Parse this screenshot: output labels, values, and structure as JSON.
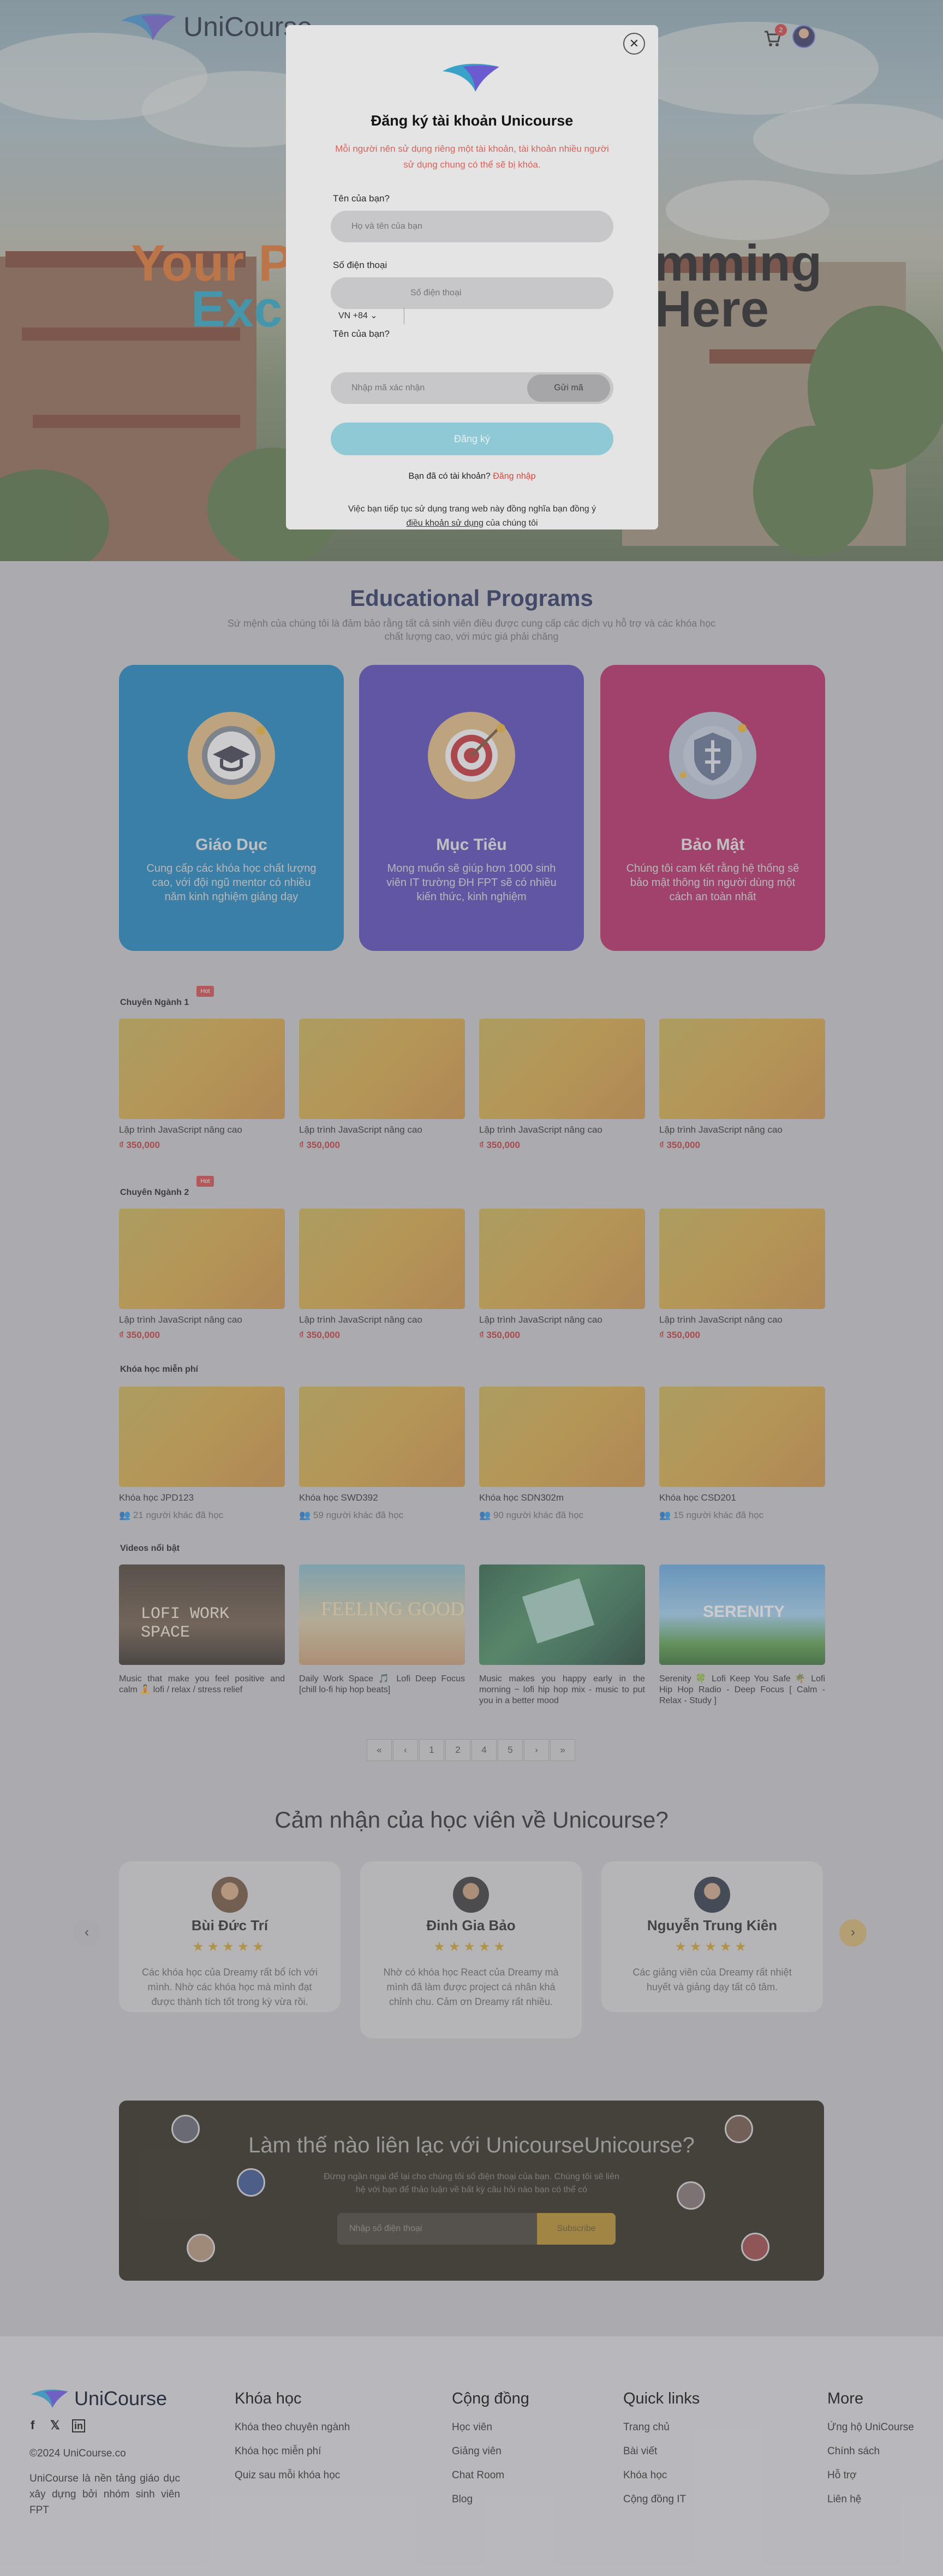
{
  "brand": {
    "name": "UniCourse",
    "accent": "#3aa1c8"
  },
  "header": {
    "cart_count": "2"
  },
  "hero": {
    "line1_left": "Your P",
    "line1_right": "mming",
    "line2_left": "Exc",
    "line2_right": "Here"
  },
  "modal": {
    "title": "Đăng ký tài khoản Unicourse",
    "subtitle": "Mỗi người nên sử dụng riêng một tài khoản, tài khoản nhiều người sử dụng chung có thể sẽ bị khóa.",
    "name_label": "Tên của bạn?",
    "name_placeholder": "Họ và tên của bạn",
    "phone_label": "Số điện thoại",
    "country": "VN +84",
    "phone_placeholder": "Số điện thoại",
    "code_label": "Tên của bạn?",
    "code_placeholder": "Nhập mã xác nhận",
    "send_code": "Gửi mã",
    "submit": "Đăng ký",
    "have_account": "Bạn đã có tài khoản?",
    "login": "Đăng nhập",
    "terms_1": "Việc bạn tiếp tục sử dụng trang web này đồng nghĩa bạn đồng ý",
    "terms_link": "điều khoản sử dụng",
    "terms_2": "của chúng tôi"
  },
  "programs": {
    "title": "Educational Programs",
    "subtitle": "Sứ mệnh của chúng tôi là đảm bảo rằng tất cả sinh viên điều được cung cấp các dịch vụ hỗ trợ và các khóa học chất lượng cao, với mức giá phải chăng",
    "cards": [
      {
        "title": "Giáo Dục",
        "text": "Cung cấp các khóa học chất lượng cao, với đội ngũ mentor có nhiều năm kinh nghiệm giảng dạy",
        "color": "#0a7fc0"
      },
      {
        "title": "Mục Tiêu",
        "text": "Mong muốn sẽ giúp hơn 1000 sinh viên IT trường ĐH FPT sẽ có nhiều kiến thức, kinh nghiệm",
        "color": "#4b3bb8"
      },
      {
        "title": "Bảo Mật",
        "text": "Chúng tôi cam kết rằng hệ thống sẽ bảo mật thông tin người dùng một cách an toàn nhất",
        "color": "#b8195c"
      }
    ]
  },
  "courses": {
    "hot": "Hot",
    "major1": {
      "title": "Chuyên Ngành 1",
      "items": [
        {
          "name": "Lập trình JavaScript nâng cao",
          "price": "₫ 350,000"
        },
        {
          "name": "Lập trình JavaScript nâng cao",
          "price": "₫ 350,000"
        },
        {
          "name": "Lập trình JavaScript nâng cao",
          "price": "₫ 350,000"
        },
        {
          "name": "Lập trình JavaScript nâng cao",
          "price": "₫ 350,000"
        }
      ]
    },
    "major2": {
      "title": "Chuyên Ngành 2",
      "items": [
        {
          "name": "Lập trình JavaScript nâng cao",
          "price": "₫ 350,000"
        },
        {
          "name": "Lập trình JavaScript nâng cao",
          "price": "₫ 350,000"
        },
        {
          "name": "Lập trình JavaScript nâng cao",
          "price": "₫ 350,000"
        },
        {
          "name": "Lập trình JavaScript nâng cao",
          "price": "₫ 350,000"
        }
      ]
    },
    "free": {
      "title": "Khóa học miễn phí",
      "items": [
        {
          "name": "Khóa học JPD123",
          "meta": "21 người khác đã học"
        },
        {
          "name": "Khóa học SWD392",
          "meta": "59 người khác đã học"
        },
        {
          "name": "Khóa học SDN302m",
          "meta": "90 người khác đã học"
        },
        {
          "name": "Khóa học CSD201",
          "meta": "15 người khác đã học"
        }
      ]
    },
    "videos": {
      "title": "Videos nổi bật",
      "items": [
        {
          "name": "Music that make you feel positive and calm 🧘 lofi / relax / stress relief",
          "caption": "LOFI WORK SPACE"
        },
        {
          "name": "Daily Work Space 🎵 Lofi Deep Focus [chill lo-fi hip hop beats]",
          "caption": "FEELING GOOD"
        },
        {
          "name": "Music makes you happy early in the morning ~ lofi hip hop mix - music to put you in a better mood",
          "caption": ""
        },
        {
          "name": "Serenity 🍀 Lofi Keep You Safe 🌴 Lofi Hip Hop Radio - Deep Focus [ Calm - Relax - Study ]",
          "caption": "SERENITY"
        }
      ]
    }
  },
  "pagination": [
    "«",
    "‹",
    "1",
    "2",
    "4",
    "5",
    "›",
    "»"
  ],
  "testimonials": {
    "title": "Cảm nhận của học viên về Unicourse?",
    "stars": "★★★★★",
    "items": [
      {
        "name": "Bùi Đức Trí",
        "text": "Các khóa học của Dreamy rất bổ ích với mình. Nhờ các khóa học mà mình đạt được thành tích tốt trong kỳ vừa rồi."
      },
      {
        "name": "Đinh Gia Bảo",
        "text": "Nhờ có khóa học React của Dreamy mà mình đã làm được project cá nhân khá chỉnh chu. Cảm ơn Dreamy rất nhiều."
      },
      {
        "name": "Nguyễn Trung Kiên",
        "text": "Các giảng viên của Dreamy rất nhiệt huyết và giảng dạy tất cô tâm."
      }
    ]
  },
  "contact": {
    "title": "Làm thế nào liên lạc với UnicourseUnicourse?",
    "subtitle": "Đừng ngần ngại để lại cho chúng tôi số điện thoại của bạn. Chúng tôi sẽ liên hệ với bạn để thảo luận về bất kỳ câu hỏi nào bạn có thể có",
    "placeholder": "Nhập số điện thoại",
    "button": "Subscribe"
  },
  "footer": {
    "brand": "UniCourse",
    "social": [
      "f",
      "𝕏",
      "in"
    ],
    "copyright": "©2024 UniCourse.co",
    "about": "UniCourse là nền tảng giáo dục xây dựng bởi nhóm sinh viên FPT",
    "columns": [
      {
        "title": "Khóa học",
        "links": [
          "Khóa theo chuyên ngành",
          "Khóa học miễn phí",
          "Quiz sau mỗi khóa học"
        ]
      },
      {
        "title": "Cộng đồng",
        "links": [
          "Học viên",
          "Giảng viên",
          "Chat Room",
          "Blog"
        ]
      },
      {
        "title": "Quick links",
        "links": [
          "Trang chủ",
          "Bài viết",
          "Khóa học",
          "Cộng đồng IT"
        ]
      },
      {
        "title": "More",
        "links": [
          "Ứng hộ UniCourse",
          "Chính sách",
          "Hỗ trợ",
          "Liên hệ"
        ]
      }
    ]
  }
}
